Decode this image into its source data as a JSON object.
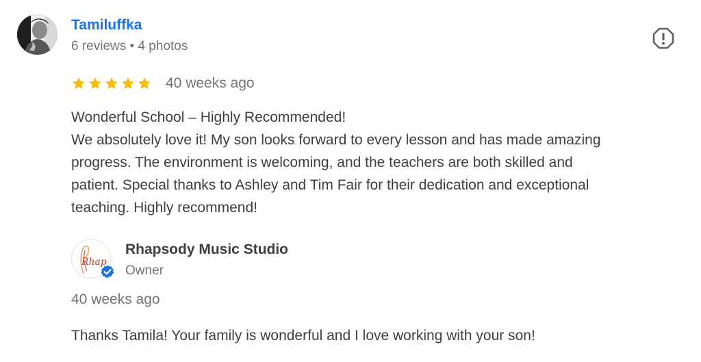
{
  "review": {
    "reviewer": {
      "name": "Tamiluffka",
      "meta": "6 reviews • 4 photos",
      "avatar": "person-photo"
    },
    "report_icon": "report-flag-icon",
    "rating": {
      "stars": 5,
      "max": 5,
      "star_color": "#fbbc04"
    },
    "date": "40 weeks ago",
    "text_lines": [
      "Wonderful School – Highly Recommended!",
      "We absolutely love it! My son looks forward to every lesson and has made amazing",
      "progress. The environment is welcoming, and the teachers are both skilled and",
      "patient. Special thanks to Ashley and Tim Fair for their dedication and exceptional",
      "teaching. Highly recommend!"
    ]
  },
  "owner_reply": {
    "name": "Rhapsody Music Studio",
    "role": "Owner",
    "logo_text": "Rhap",
    "verified_icon": "verified-check-icon",
    "date": "40 weeks ago",
    "text": "Thanks Tamila! Your family is wonderful and I love working with your son!"
  },
  "colors": {
    "link_blue": "#1a73e8",
    "text_primary": "#3c4043",
    "text_secondary": "#70757a",
    "verified_blue": "#1a73e8"
  }
}
